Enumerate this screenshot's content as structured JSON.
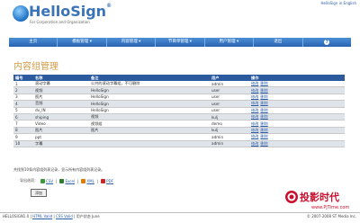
{
  "header": {
    "logo_text": "HelloSign",
    "logo_reg": "®",
    "tagline": "For Corporation and Organization",
    "top_link": "HelloSign in English"
  },
  "nav": [
    {
      "label": "主页"
    },
    {
      "label": "模板管理 ▾"
    },
    {
      "label": "内容管理 ▾"
    },
    {
      "label": "节目单管理 ▾"
    },
    {
      "label": "用户管理 ▾"
    },
    {
      "label": "退出"
    }
  ],
  "page": {
    "title": "内容组管理"
  },
  "table": {
    "headers": [
      "编号",
      "名称",
      "备注",
      "用户",
      "操作"
    ],
    "rows": [
      {
        "id": "1",
        "name": "滚动字幕",
        "note": "公共的滚动字幕组，不可删除",
        "user": "admin",
        "edit": "修改",
        "delete": "删除"
      },
      {
        "id": "2",
        "name": "视频",
        "note": "HelloSign",
        "user": "user",
        "edit": "修改",
        "delete": "删除"
      },
      {
        "id": "3",
        "name": "图片",
        "note": "HelloSign",
        "user": "user",
        "edit": "修改",
        "delete": "删除"
      },
      {
        "id": "4",
        "name": "音频",
        "note": "HelloSign",
        "user": "user",
        "edit": "修改",
        "delete": "删除"
      },
      {
        "id": "5",
        "name": "dv_IN",
        "note": "HelloSign",
        "user": "user",
        "edit": "修改",
        "delete": "删除"
      },
      {
        "id": "6",
        "name": "shiping",
        "note": "视频",
        "user": "kulj",
        "edit": "修改",
        "delete": "删除"
      },
      {
        "id": "7",
        "name": "Video",
        "note": "视频组",
        "user": "demo",
        "edit": "修改",
        "delete": "删除"
      },
      {
        "id": "8",
        "name": "图片",
        "note": "图片",
        "user": "kulj",
        "edit": "修改",
        "delete": "删除"
      },
      {
        "id": "9",
        "name": "ppt",
        "note": "",
        "user": "admin",
        "edit": "修改",
        "delete": "删除"
      },
      {
        "id": "10",
        "name": "字幕",
        "note": "",
        "user": "admin",
        "edit": "修改",
        "delete": "删除"
      }
    ]
  },
  "summary": "共找到10条内容组列表记录，显示所有内容组列表记录。",
  "export": {
    "label": "导出选项：",
    "options": [
      {
        "label": "CSV",
        "icon": "csv-icon",
        "color": "#3a9a3a"
      },
      {
        "label": "Excel",
        "icon": "excel-icon",
        "color": "#2e7d32"
      },
      {
        "label": "XML",
        "icon": "xml-icon",
        "color": "#e07b00"
      },
      {
        "label": "PDF",
        "icon": "pdf-icon",
        "color": "#c62828"
      }
    ],
    "separator": "|"
  },
  "add_button": "添加",
  "watermark": {
    "text": "投影时代",
    "url": "www.PjTime.com"
  },
  "footer": {
    "left_prefix": "HELLOSIGN1.0 |",
    "html_valid": "HTML Valid",
    "css_valid": "CSS Valid",
    "left_suffix": "| 用户状态 June",
    "right": "© 2007-2008 ST Media Inc."
  },
  "colors": {
    "nav_bg": "#2763b1",
    "table_header": "#2b5a9e",
    "title": "#d39a45",
    "link": "#2a5ca8",
    "row_alt": "#dfe4ea"
  }
}
